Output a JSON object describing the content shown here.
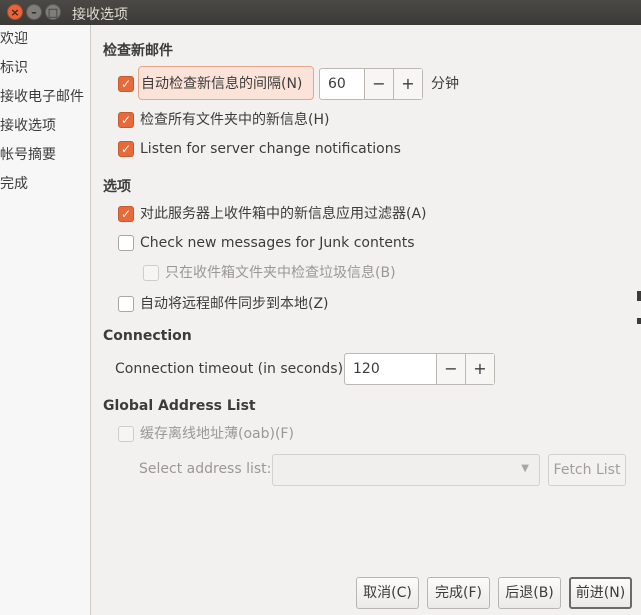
{
  "window": {
    "title": "接收选项"
  },
  "sidebar": {
    "items": [
      {
        "label": "欢迎"
      },
      {
        "label": "标识"
      },
      {
        "label": "接收电子邮件"
      },
      {
        "label": "接收选项"
      },
      {
        "label": "帐号摘要"
      },
      {
        "label": "完成"
      }
    ]
  },
  "new_mail": {
    "header": "检查新邮件",
    "auto_check_label": "自动检查新信息的间隔(N)",
    "auto_check_checked": true,
    "interval_value": "60",
    "interval_unit": "分钟",
    "check_all_label": "检查所有文件夹中的新信息(H)",
    "check_all_checked": true,
    "listen_label": "Listen for server change notifications",
    "listen_checked": true
  },
  "options": {
    "header": "选项",
    "filter_label": "对此服务器上收件箱中的新信息应用过滤器(A)",
    "filter_checked": true,
    "junk_label": "Check new messages for Junk contents",
    "junk_checked": false,
    "inbox_only_label": "只在收件箱文件夹中检查垃圾信息(B)",
    "inbox_only_checked": false,
    "sync_label": "自动将远程邮件同步到本地(Z)",
    "sync_checked": false
  },
  "connection": {
    "header": "Connection",
    "timeout_label": "Connection timeout (in seconds)",
    "timeout_value": "120"
  },
  "gal": {
    "header": "Global Address List",
    "cache_label": "缓存离线地址薄(oab)(F)",
    "cache_checked": false,
    "select_label": "Select address list:",
    "select_value": "",
    "fetch_label": "Fetch List"
  },
  "buttons": {
    "cancel": "取消(C)",
    "finish": "完成(F)",
    "back": "后退(B)",
    "forward": "前进(N)"
  },
  "spin_symbols": {
    "minus": "−",
    "plus": "+"
  },
  "colors": {
    "accent": "#e86a3a",
    "titlebar": "#3c3b37",
    "close_button": "#e9643a"
  }
}
